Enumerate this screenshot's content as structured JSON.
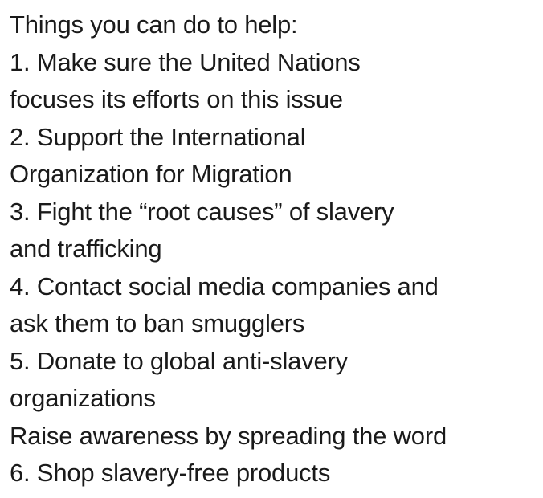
{
  "heading": "Things you can do to help:",
  "lines": [
    "1. Make sure the United Nations",
    "focuses its efforts on this issue",
    "2. Support the International",
    "Organization for Migration",
    "3. Fight the “root causes” of slavery",
    "and trafficking",
    "4. Contact social media companies and",
    "ask them to ban smugglers",
    "5. Donate to global anti-slavery",
    "organizations",
    "Raise awareness by spreading the word",
    "6. Shop slavery-free products"
  ],
  "colors": {
    "text": "#1a1a1a",
    "background": "#ffffff"
  }
}
